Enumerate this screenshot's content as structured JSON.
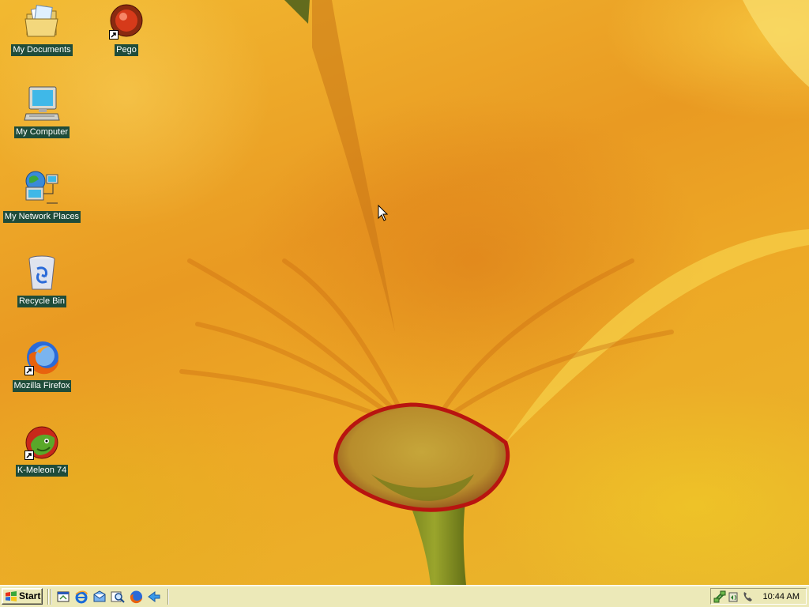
{
  "desktop": {
    "icons": [
      {
        "label": "My Documents",
        "icon": "folder-icon",
        "shortcut": false
      },
      {
        "label": "Pego",
        "icon": "pego-icon",
        "shortcut": true
      },
      {
        "label": "My Computer",
        "icon": "computer-icon",
        "shortcut": false
      },
      {
        "label": "My Network Places",
        "icon": "network-icon",
        "shortcut": false
      },
      {
        "label": "Recycle Bin",
        "icon": "recycle-bin-icon",
        "shortcut": false
      },
      {
        "label": "Mozilla Firefox",
        "icon": "firefox-icon",
        "shortcut": true
      },
      {
        "label": "K-Meleon 74",
        "icon": "kmeleon-icon",
        "shortcut": true
      }
    ],
    "label_background": "#1f4c3a"
  },
  "taskbar": {
    "start_label": "Start",
    "quick_launch": [
      "show-desktop-icon",
      "internet-explorer-icon",
      "outlook-express-icon",
      "search-icon",
      "firefox-icon",
      "arrow-icon"
    ],
    "tray_icons": [
      "network-tray-icon",
      "volume-tray-icon",
      "phone-tray-icon"
    ],
    "clock": "10:44 AM",
    "background": "#ece9b8"
  }
}
